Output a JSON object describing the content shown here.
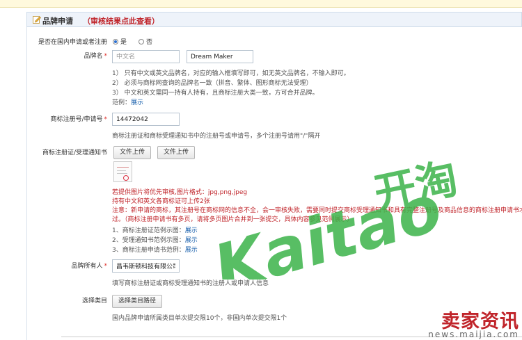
{
  "header": {
    "title": "品牌申请",
    "review_link": "（审核结果点此查看）"
  },
  "domestic": {
    "label": "是否在国内申请或者注册",
    "yes": "是",
    "no": "否",
    "selected": "是"
  },
  "brand_name": {
    "label": "品牌名",
    "cn_placeholder": "中文名",
    "en_value": "Dream Maker",
    "notes": [
      "1） 只有中文或英文品牌名，对应的输入框填写即可，如无英文品牌名，不输入即可。",
      "2） 必须与商标网查询的品牌名一致（拼音、繁体、图形商标无法受理）",
      "3） 中文和英文需同一持有人持有，且商标注册大类一致，方可合并品牌。"
    ],
    "example_label": "范例：",
    "example_link": "展示"
  },
  "reg_no": {
    "label": "商标注册号/申请号",
    "value": "14472042",
    "note": "商标注册证和商标受理通知书中的注册号或申请号，多个注册号请用\"/\"隔开"
  },
  "cert": {
    "label": "商标注册证/受理通知书",
    "upload1": "文件上传",
    "upload2": "文件上传",
    "red_lines": [
      "若提供图片将优先审核,图片格式：jpg,png,jpeg",
      "持有中文和英文各商标证可上传2张",
      "注意：新申请的商标，其注册号在商标网的信息不全，会一审核失败，需要同时提交商标受理通知书和具有完整注册号及商品信息的商标注册申请书才能",
      "过。（商标注册申请书有多页，请将多页图片合并到一张提交，具体内容参见范例展示）"
    ],
    "examples": [
      {
        "label": "1、商标注册证范例示图：",
        "link": "展示"
      },
      {
        "label": "2、受理通知书范例示图：",
        "link": "展示"
      },
      {
        "label": "3、商标注册申请书范例：",
        "link": "展示"
      }
    ]
  },
  "owner": {
    "label": "品牌所有人",
    "value": "昌韦斯顿科技有限公司",
    "note": "填写商标注册证或商标受理通知书的注册人或申请人信息"
  },
  "category": {
    "label": "选择类目",
    "button": "选择类目路径",
    "note": "国内品牌申请所属类目单次提交限10个，非国内单次提交限1个"
  },
  "watermark": {
    "latin": "Kaitao",
    "cn": "开淘"
  },
  "footer_logo": {
    "cn": "卖家资讯",
    "url": "news.maijia.com"
  },
  "colors": {
    "accent_red": "#c0242a",
    "link_blue": "#2367b0",
    "watermark_green": "#3cb34a",
    "header_bg": "#eef3fa"
  }
}
